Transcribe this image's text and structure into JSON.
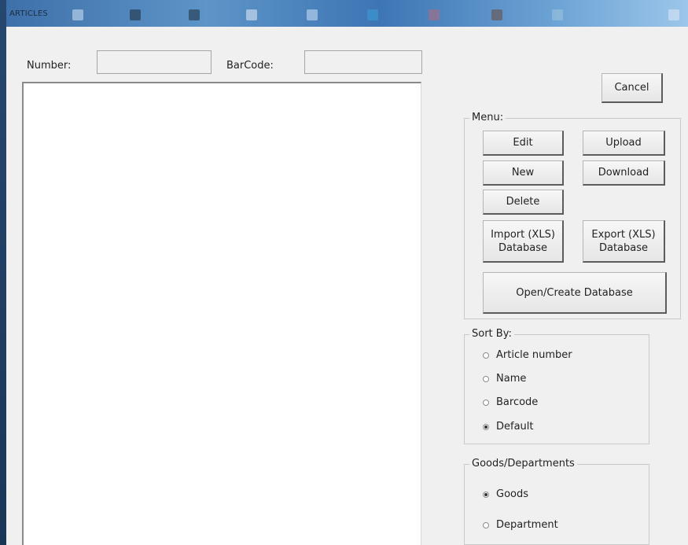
{
  "window": {
    "title": "ARTICLES"
  },
  "search": {
    "number_label": "Number:",
    "number_value": "",
    "barcode_label": "BarCode:",
    "barcode_value": ""
  },
  "buttons": {
    "cancel": "Cancel"
  },
  "menu": {
    "title": "Menu:",
    "edit": "Edit",
    "upload": "Upload",
    "new": "New",
    "download": "Download",
    "delete": "Delete",
    "import": "Import (XLS)\nDatabase",
    "export": "Export (XLS)\nDatabase",
    "open_create": "Open/Create Database"
  },
  "sort_by": {
    "title": "Sort By:",
    "options": [
      {
        "label": "Article number",
        "checked": false
      },
      {
        "label": "Name",
        "checked": false
      },
      {
        "label": "Barcode",
        "checked": false
      },
      {
        "label": "Default",
        "checked": true
      }
    ]
  },
  "goods_departments": {
    "title": "Goods/Departments",
    "options": [
      {
        "label": "Goods",
        "checked": true
      },
      {
        "label": "Department",
        "checked": false
      }
    ]
  }
}
